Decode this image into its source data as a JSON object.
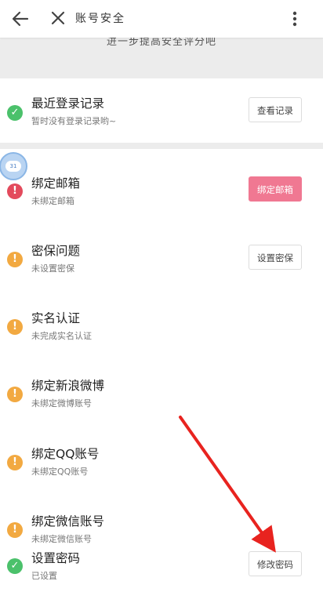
{
  "header": {
    "title": "账号安全"
  },
  "banner": {
    "text": "进一步提高安全评分吧"
  },
  "rows": [
    {
      "title": "最近登录记录",
      "subtitle": "暂时没有登录记录哟~",
      "status": "green",
      "button": "查看记录"
    },
    {
      "title": "绑定邮箱",
      "subtitle": "未绑定邮箱",
      "status": "red",
      "button": "绑定邮箱"
    },
    {
      "title": "密保问题",
      "subtitle": "未设置密保",
      "status": "orange",
      "button": "设置密保"
    },
    {
      "title": "实名认证",
      "subtitle": "未完成实名认证",
      "status": "orange"
    },
    {
      "title": "绑定新浪微博",
      "subtitle": "未绑定微博账号",
      "status": "orange"
    },
    {
      "title": "绑定QQ账号",
      "subtitle": "未绑定QQ账号",
      "status": "orange"
    },
    {
      "title": "绑定微信账号",
      "subtitle": "未绑定微信账号",
      "status": "orange"
    },
    {
      "title": "设置密码",
      "subtitle": "已设置",
      "status": "green",
      "button": "修改密码"
    }
  ],
  "avatar": {
    "badge": "31"
  },
  "colors": {
    "accent_pink": "#f07892",
    "status_green": "#4bc16b",
    "status_red": "#e34a5c",
    "status_orange": "#f2a941",
    "arrow": "#e8231f"
  },
  "icons": {
    "back": "arrow-left-icon",
    "close": "close-icon",
    "more": "more-vertical-icon",
    "check": "check-icon",
    "alert": "exclamation-icon"
  }
}
